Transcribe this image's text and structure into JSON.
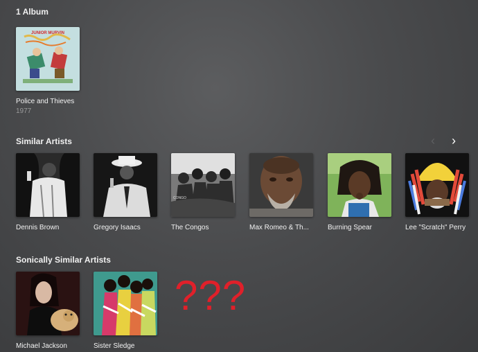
{
  "albums_section": {
    "title": "1 Album",
    "items": [
      {
        "title": "Police and Thieves",
        "year": "1977",
        "cover_text": "JUNIOR MURVIN"
      }
    ]
  },
  "similar_section": {
    "title": "Similar Artists",
    "nav": {
      "prev_icon": "chevron-left-icon",
      "next_icon": "chevron-right-icon"
    },
    "items": [
      {
        "name": "Dennis Brown"
      },
      {
        "name": "Gregory Isaacs"
      },
      {
        "name": "The Congos",
        "photo_text": "CONGO"
      },
      {
        "name": "Max Romeo & Th..."
      },
      {
        "name": "Burning Spear"
      },
      {
        "name": "Lee \"Scratch\" Perry"
      }
    ]
  },
  "sonic_section": {
    "title": "Sonically Similar Artists",
    "items": [
      {
        "name": "Michael Jackson"
      },
      {
        "name": "Sister Sledge"
      }
    ],
    "annotation": "???"
  },
  "colors": {
    "background": "#4a4b4d",
    "annotation": "#e0202a",
    "subtext": "#9a9a9a"
  }
}
